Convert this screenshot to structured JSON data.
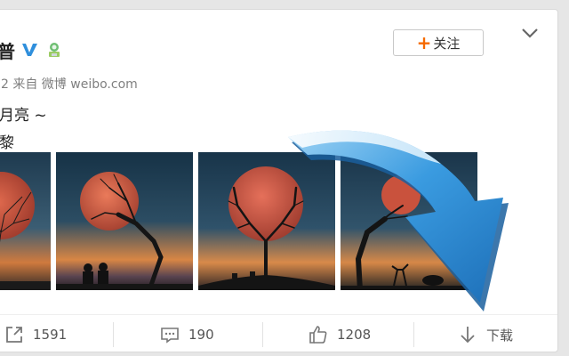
{
  "post": {
    "username": "普",
    "meta": "2 来自 微博 weibo.com",
    "text_line1": "月亮 ~",
    "text_line2": "黎",
    "follow_label": "关注",
    "follow_plus": "+"
  },
  "actions": {
    "share_count": "1591",
    "comment_count": "190",
    "like_count": "1208",
    "download_label": "下载"
  },
  "icons": {
    "verify": "verified-v-icon",
    "member": "member-badge-icon",
    "menu": "chevron-down-icon",
    "share": "share-icon",
    "comment": "comment-icon",
    "like": "thumbs-up-icon",
    "download": "download-arrow-icon",
    "overlay": "curved-blue-arrow-icon"
  },
  "colors": {
    "accent_orange": "#f56a00",
    "verify_blue": "#2f8fdc",
    "arrow_blue": "#2e8fd8"
  }
}
